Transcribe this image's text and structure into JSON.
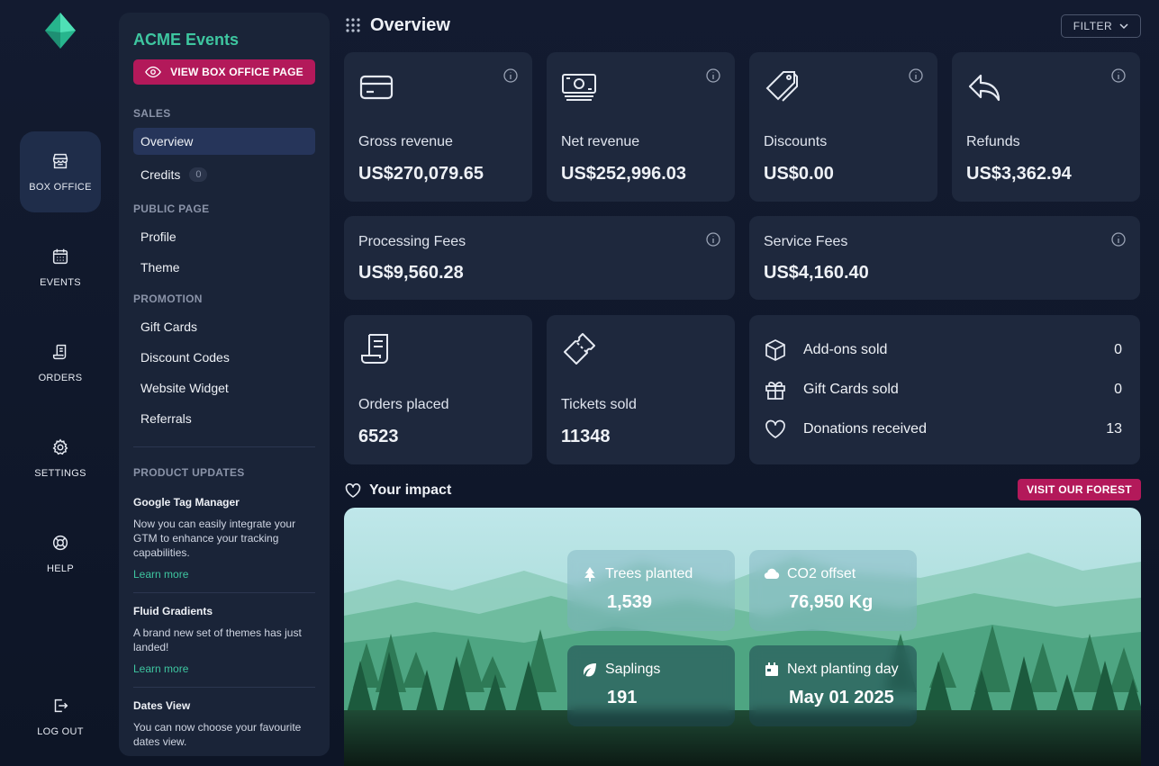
{
  "rail": {
    "items": [
      {
        "label": "BOX OFFICE",
        "icon": "store-icon",
        "active": true
      },
      {
        "label": "EVENTS",
        "icon": "calendar-icon"
      },
      {
        "label": "ORDERS",
        "icon": "receipt-icon"
      },
      {
        "label": "SETTINGS",
        "icon": "gear-icon"
      },
      {
        "label": "HELP",
        "icon": "lifebuoy-icon"
      },
      {
        "label": "LOG OUT",
        "icon": "logout-icon"
      }
    ]
  },
  "sidebar": {
    "org_name": "ACME Events",
    "view_button": "VIEW BOX OFFICE PAGE",
    "sections": {
      "sales": "SALES",
      "public_page": "PUBLIC PAGE",
      "promotion": "PROMOTION",
      "product_updates": "PRODUCT UPDATES"
    },
    "sales_items": [
      {
        "label": "Overview",
        "active": true
      },
      {
        "label": "Credits",
        "badge": "0"
      }
    ],
    "public_items": [
      {
        "label": "Profile"
      },
      {
        "label": "Theme"
      }
    ],
    "promotion_items": [
      {
        "label": "Gift Cards"
      },
      {
        "label": "Discount Codes"
      },
      {
        "label": "Website Widget"
      },
      {
        "label": "Referrals"
      }
    ],
    "updates": [
      {
        "title": "Google Tag Manager",
        "text": "Now you can easily integrate your GTM to enhance your tracking capabilities.",
        "link": "Learn more"
      },
      {
        "title": "Fluid Gradients",
        "text": "A brand new set of themes has just landed!",
        "link": "Learn more"
      },
      {
        "title": "Dates View",
        "text": "You can now choose your favourite dates view."
      }
    ]
  },
  "main": {
    "title": "Overview",
    "filter_label": "FILTER",
    "cards": {
      "gross": {
        "label": "Gross revenue",
        "value": "US$270,079.65"
      },
      "net": {
        "label": "Net revenue",
        "value": "US$252,996.03"
      },
      "discounts": {
        "label": "Discounts",
        "value": "US$0.00"
      },
      "refunds": {
        "label": "Refunds",
        "value": "US$3,362.94"
      },
      "processing": {
        "label": "Processing Fees",
        "value": "US$9,560.28"
      },
      "service": {
        "label": "Service Fees",
        "value": "US$4,160.40"
      },
      "orders": {
        "label": "Orders placed",
        "value": "6523"
      },
      "tickets": {
        "label": "Tickets sold",
        "value": "11348"
      }
    },
    "extras": [
      {
        "label": "Add-ons sold",
        "value": "0"
      },
      {
        "label": "Gift Cards sold",
        "value": "0"
      },
      {
        "label": "Donations received",
        "value": "13"
      }
    ],
    "impact": {
      "title": "Your impact",
      "button": "VISIT OUR FOREST",
      "stats": {
        "trees": {
          "label": "Trees planted",
          "value": "1,539"
        },
        "co2": {
          "label": "CO2 offset",
          "value": "76,950 Kg"
        },
        "saplings": {
          "label": "Saplings",
          "value": "191"
        },
        "planting": {
          "label": "Next planting day",
          "value": "May 01 2025"
        }
      }
    }
  },
  "colors": {
    "accent_green": "#3ec6a0",
    "accent_pink": "#b3195a",
    "card_bg": "#1e283d",
    "sidebar_bg": "#1a2438"
  }
}
